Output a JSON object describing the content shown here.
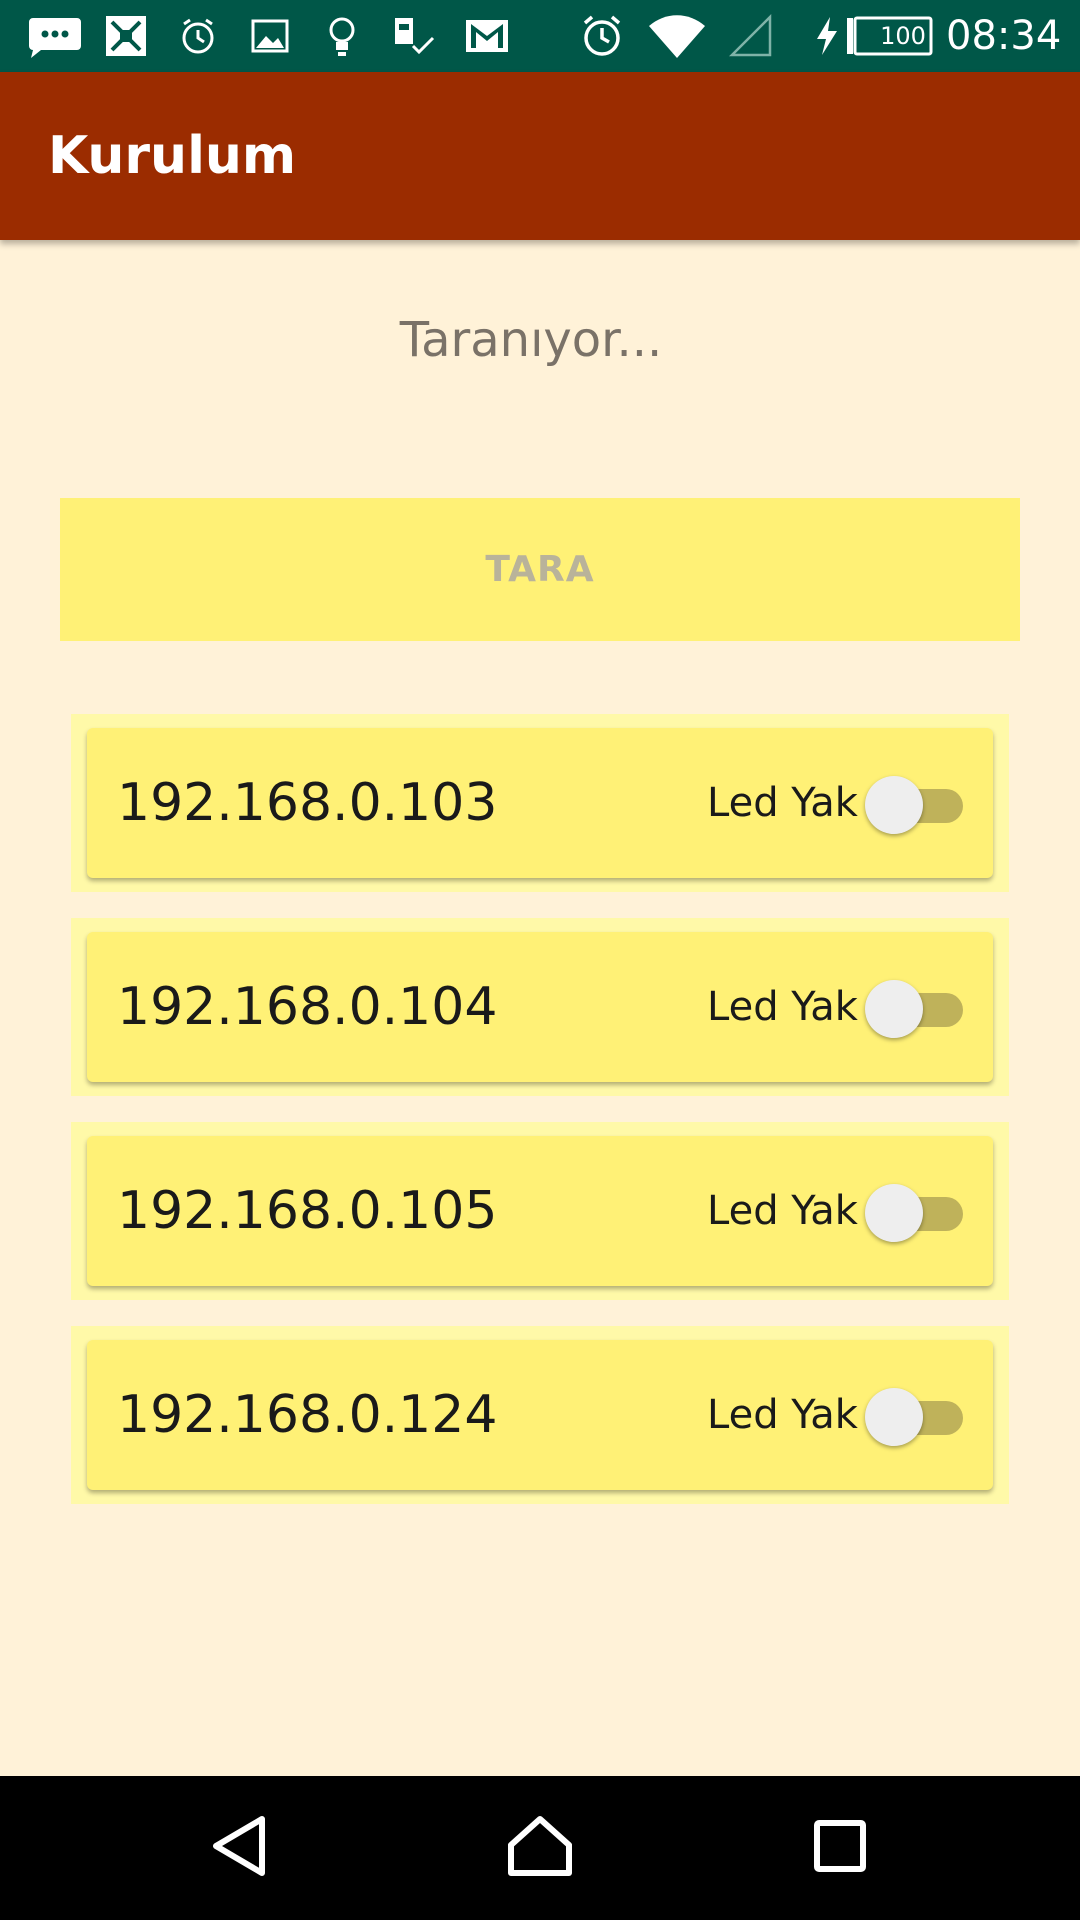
{
  "status_bar": {
    "time": "08:34",
    "battery_level": "100",
    "icons": [
      "chat-notification-icon",
      "app-notification-icon",
      "alarm-notification-icon",
      "image-notification-icon",
      "bulb-notification-icon",
      "sim-check-notification-icon",
      "gmail-icon",
      "alarm-clock-icon",
      "wifi-icon",
      "cellular-signal-icon",
      "battery-charging-icon"
    ],
    "colors": {
      "background": "#005748"
    }
  },
  "app_bar": {
    "title": "Kurulum",
    "colors": {
      "background": "#9b2c00"
    }
  },
  "main": {
    "scan_status": "Taranıyor...",
    "scan_button_label": "TARA",
    "colors": {
      "background": "#fff2d8",
      "button": "#fff176",
      "card": "#fff176",
      "card_outer": "#fff9a8",
      "switch_track": "#bfb25a"
    }
  },
  "devices": [
    {
      "ip": "192.168.0.103",
      "switch_label": "Led Yak",
      "led_on": false
    },
    {
      "ip": "192.168.0.104",
      "switch_label": "Led Yak",
      "led_on": false
    },
    {
      "ip": "192.168.0.105",
      "switch_label": "Led Yak",
      "led_on": false
    },
    {
      "ip": "192.168.0.124",
      "switch_label": "Led Yak",
      "led_on": false
    }
  ],
  "nav_bar": {
    "buttons": [
      "back-icon",
      "home-icon",
      "recents-icon"
    ]
  }
}
